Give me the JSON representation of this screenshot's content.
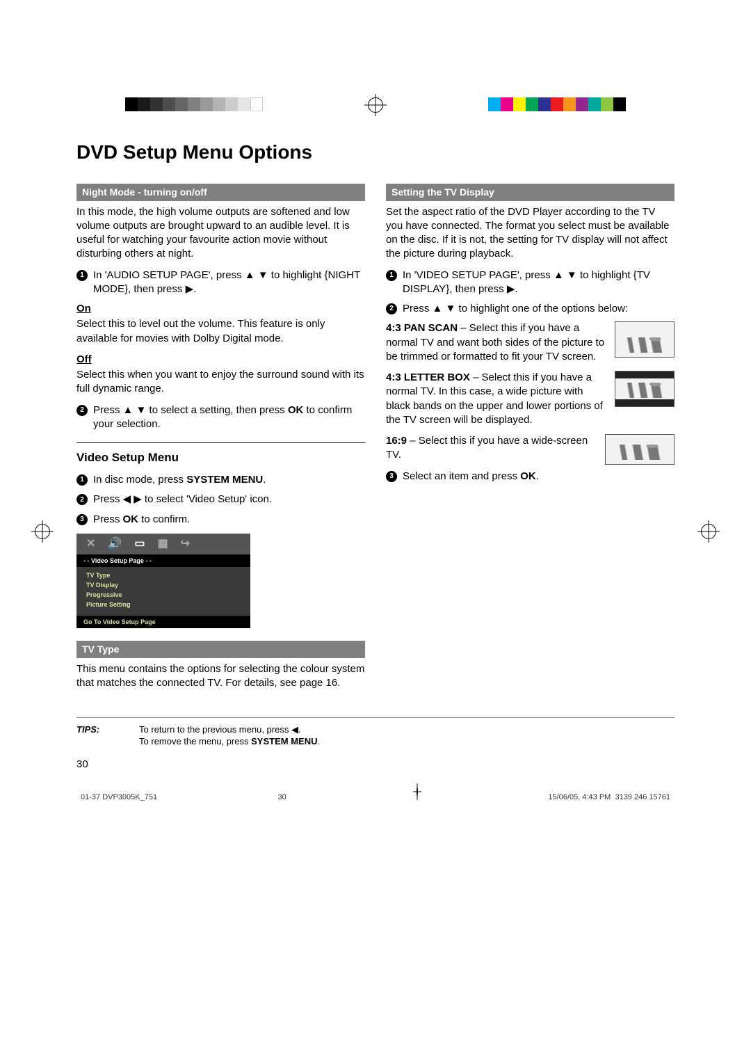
{
  "page": {
    "title": "DVD Setup Menu Options",
    "number": "30"
  },
  "left": {
    "bar1": "Night Mode - turning on/off",
    "intro": "In this mode, the high volume outputs are softened and low volume outputs are brought upward to an audible level.  It is useful for watching your favourite action movie without disturbing others at night.",
    "step1_a": "In 'AUDIO SETUP PAGE', press ",
    "step1_b": " to highlight {NIGHT MODE}, then press ",
    "on_label": "On",
    "on_text": "Select this to level out the volume.  This feature is only available for movies with Dolby Digital mode.",
    "off_label": "Off",
    "off_text": "Select this when you want to enjoy the surround sound with its full dynamic range.",
    "step2_a": "Press ",
    "step2_b": " to select a setting, then press ",
    "step2_ok": "OK",
    "step2_c": " to confirm your selection.",
    "sub_heading": "Video Setup Menu",
    "vs_step1_a": "In disc mode, press ",
    "vs_step1_b": "SYSTEM MENU",
    "vs_step1_c": ".",
    "vs_step2_a": "Press ",
    "vs_step2_b": " to select 'Video Setup' icon.",
    "vs_step3_a": "Press ",
    "vs_step3_ok": "OK",
    "vs_step3_b": " to confirm.",
    "menu_title": "- -   Video Setup Page   - -",
    "menu_items": [
      "TV Type",
      "TV Display",
      "Progressive",
      "Picture Setting"
    ],
    "menu_footer": "Go To Video Setup Page",
    "bar2": "TV Type",
    "tvtype_text": "This menu contains the options for selecting the colour system that matches the connected TV.  For details, see page 16."
  },
  "right": {
    "bar1": "Setting the TV Display",
    "intro": "Set the aspect ratio of the DVD Player according to the TV you have connected. The format you select must be available on the disc.  If it is not, the setting for TV display will not affect the picture during playback.",
    "step1_a": "In 'VIDEO SETUP PAGE', press ",
    "step1_b": " to highlight {TV DISPLAY}, then press ",
    "step2_a": "Press ",
    "step2_b": " to highlight one of the options below:",
    "panscan_label": "4:3 PAN SCAN",
    "panscan_dash": " – ",
    "panscan_text": "Select this if you have a normal TV and want both sides of the picture to be trimmed or formatted to fit your TV screen.",
    "letterbox_label": "4:3 LETTER BOX",
    "letterbox_dash": " – ",
    "letterbox_text": "Select this if you have a normal TV. In this case, a wide picture with black bands on the upper and lower portions of the TV screen will be displayed.",
    "r169_label": "16:9",
    "r169_dash": " – ",
    "r169_text": "Select this if you have a wide-screen TV.",
    "step3_a": "Select an item and press ",
    "step3_ok": "OK",
    "step3_b": "."
  },
  "tips": {
    "label": "TIPS:",
    "line1_a": "To return to the previous menu, press ",
    "line1_b": ".",
    "line2_a": "To remove the menu, press ",
    "line2_sys": "SYSTEM MENU",
    "line2_b": "."
  },
  "footer": {
    "file": "01-37 DVP3005K_751",
    "mid": "30",
    "date": "15/06/05, 4:43 PM",
    "code": "3139 246 15761"
  },
  "glyphs": {
    "up": "▲",
    "down": "▼",
    "left": "◀",
    "right": "▶",
    "updown": "▲ ▼",
    "leftright": "◀ ▶"
  }
}
